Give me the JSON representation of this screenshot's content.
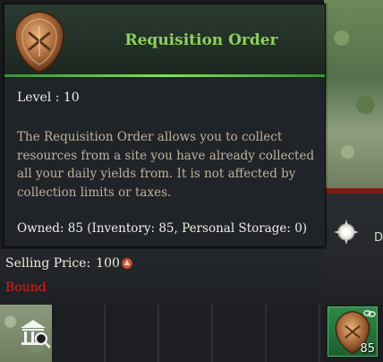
{
  "tooltip": {
    "title": "Requisition Order",
    "level": "Level : 10",
    "description": "The Requisition Order allows you to collect resources from a site you have already collected all your daily yields from. It is not affected by collection limits or taxes.",
    "owned": "Owned: 85 (Inventory: 85, Personal Storage: 0)",
    "selling_price_label": "Selling Price:",
    "selling_price_value": "100",
    "bound": "Bound",
    "title_color": "#8ed15a",
    "bound_color": "#e0201a",
    "icon": "requisition-order-icon"
  },
  "side_panel": {
    "label": "D",
    "icon": "compass-icon"
  },
  "item_slot": {
    "count": "85",
    "icon": "requisition-order-icon"
  },
  "market_button": {
    "icon": "marketplace-search-icon"
  }
}
